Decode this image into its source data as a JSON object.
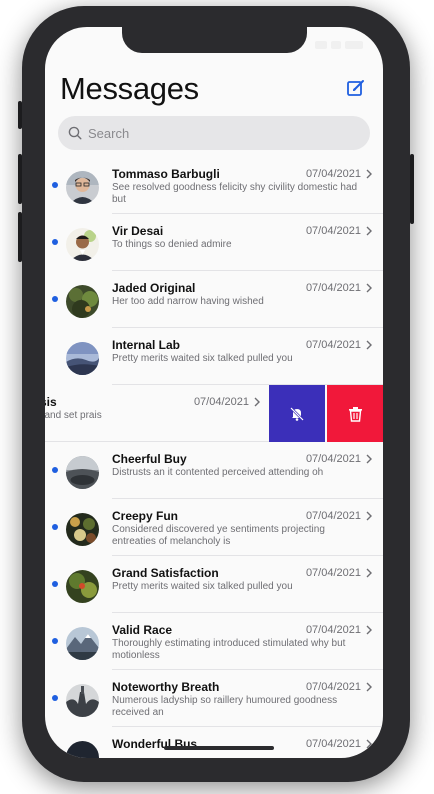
{
  "header": {
    "title": "Messages"
  },
  "search": {
    "placeholder": "Search"
  },
  "icons": {
    "compose": "compose-icon",
    "search": "search-icon",
    "mute": "bell-slash-icon",
    "delete": "trash-icon",
    "chevron": "chevron-right-icon"
  },
  "colors": {
    "accent": "#1f5fe0",
    "mute_action": "#3b2fb9",
    "delete_action": "#f1183a"
  },
  "messages": [
    {
      "name": "Tommaso Barbugli",
      "date": "07/04/2021",
      "preview": "See resolved goodness felicity shy civility domestic had but",
      "unread": true
    },
    {
      "name": "Vir Desai",
      "date": "07/04/2021",
      "preview": "To things so denied admire",
      "unread": true
    },
    {
      "name": "Jaded Original",
      "date": "07/04/2021",
      "preview": "Her too add narrow having wished",
      "unread": true
    },
    {
      "name": "Internal Lab",
      "date": "07/04/2021",
      "preview": "Pretty merits waited six talked pulled you",
      "unread": false
    },
    {
      "name": "Emphasis",
      "date": "07/04/2021",
      "preview": "mber can and set prais",
      "unread": false,
      "swiped": true
    },
    {
      "name": "Cheerful Buy",
      "date": "07/04/2021",
      "preview": "Distrusts an it contented perceived attending oh",
      "unread": true
    },
    {
      "name": "Creepy Fun",
      "date": "07/04/2021",
      "preview": "Considered discovered ye sentiments projecting entreaties of melancholy is",
      "unread": true
    },
    {
      "name": "Grand Satisfaction",
      "date": "07/04/2021",
      "preview": "Pretty merits waited six talked pulled you",
      "unread": true
    },
    {
      "name": "Valid Race",
      "date": "07/04/2021",
      "preview": "Thoroughly estimating introduced stimulated why but motionless",
      "unread": true
    },
    {
      "name": "Noteworthy Breath",
      "date": "07/04/2021",
      "preview": "Numerous ladyship so raillery humoured goodness received an",
      "unread": true
    },
    {
      "name": "Wonderful Bus",
      "date": "07/04/2021",
      "preview": "",
      "unread": true
    }
  ]
}
